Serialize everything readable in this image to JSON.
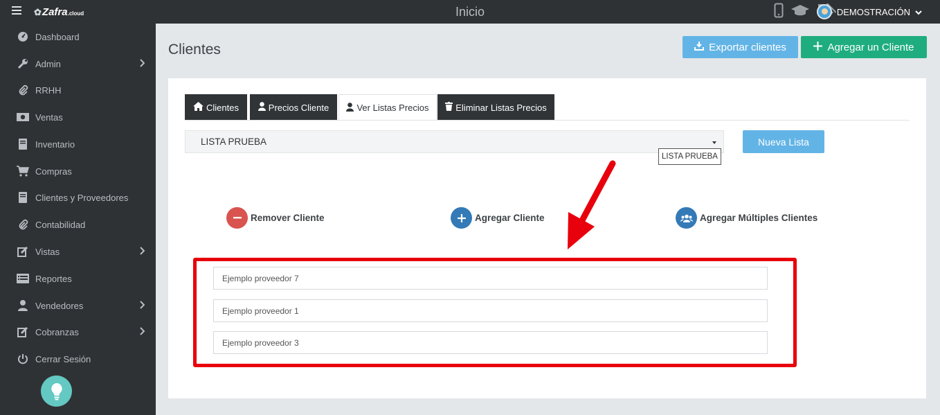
{
  "topbar": {
    "title": "Inicio",
    "brand": "Zafra",
    "brand_suffix": ".cloud",
    "user": "DEMOSTRACIÓN"
  },
  "sidebar": {
    "items": [
      {
        "label": "Dashboard",
        "icon": "dashboard-icon",
        "chevron": false
      },
      {
        "label": "Admin",
        "icon": "wrench-icon",
        "chevron": true
      },
      {
        "label": "RRHH",
        "icon": "paperclip-icon",
        "chevron": false
      },
      {
        "label": "Ventas",
        "icon": "money-icon",
        "chevron": false
      },
      {
        "label": "Inventario",
        "icon": "book-icon",
        "chevron": false
      },
      {
        "label": "Compras",
        "icon": "cart-icon",
        "chevron": false
      },
      {
        "label": "Clientes y Proveedores",
        "icon": "book-icon",
        "chevron": false
      },
      {
        "label": "Contabilidad",
        "icon": "paperclip-icon",
        "chevron": false
      },
      {
        "label": "Vistas",
        "icon": "edit-icon",
        "chevron": true
      },
      {
        "label": "Reportes",
        "icon": "list-icon",
        "chevron": false
      },
      {
        "label": "Vendedores",
        "icon": "user-icon",
        "chevron": true
      },
      {
        "label": "Cobranzas",
        "icon": "edit-icon",
        "chevron": true
      },
      {
        "label": "Cerrar Sesión",
        "icon": "power-icon",
        "chevron": false
      }
    ]
  },
  "page": {
    "title": "Clientes",
    "export_label": "Exportar clientes",
    "add_label": "Agregar un Cliente"
  },
  "tabs": [
    {
      "label": "Clientes",
      "icon": "home-icon",
      "active": false
    },
    {
      "label": "Precios Cliente",
      "icon": "user-icon",
      "active": false
    },
    {
      "label": "Ver Listas Precios",
      "icon": "user-icon",
      "active": true
    },
    {
      "label": "Eliminar Listas Precios",
      "icon": "trash-icon",
      "active": false
    }
  ],
  "list_select": {
    "value": "LISTA PRUEBA",
    "tooltip": "LISTA PRUEBA"
  },
  "new_list_label": "Nueva Lista",
  "actions": {
    "remove": "Remover Cliente",
    "add": "Agregar Cliente",
    "add_multiple": "Agregar Múltiples Clientes"
  },
  "clients": [
    "Ejemplo proveedor 7",
    "Ejemplo proveedor 1",
    "Ejemplo proveedor 3"
  ],
  "colors": {
    "sidebar_bg": "#2f3234",
    "primary_light": "#63b4e6",
    "success": "#1fad7f",
    "danger": "#d9534f",
    "info": "#337ab7",
    "annotation_red": "#e8000c"
  }
}
